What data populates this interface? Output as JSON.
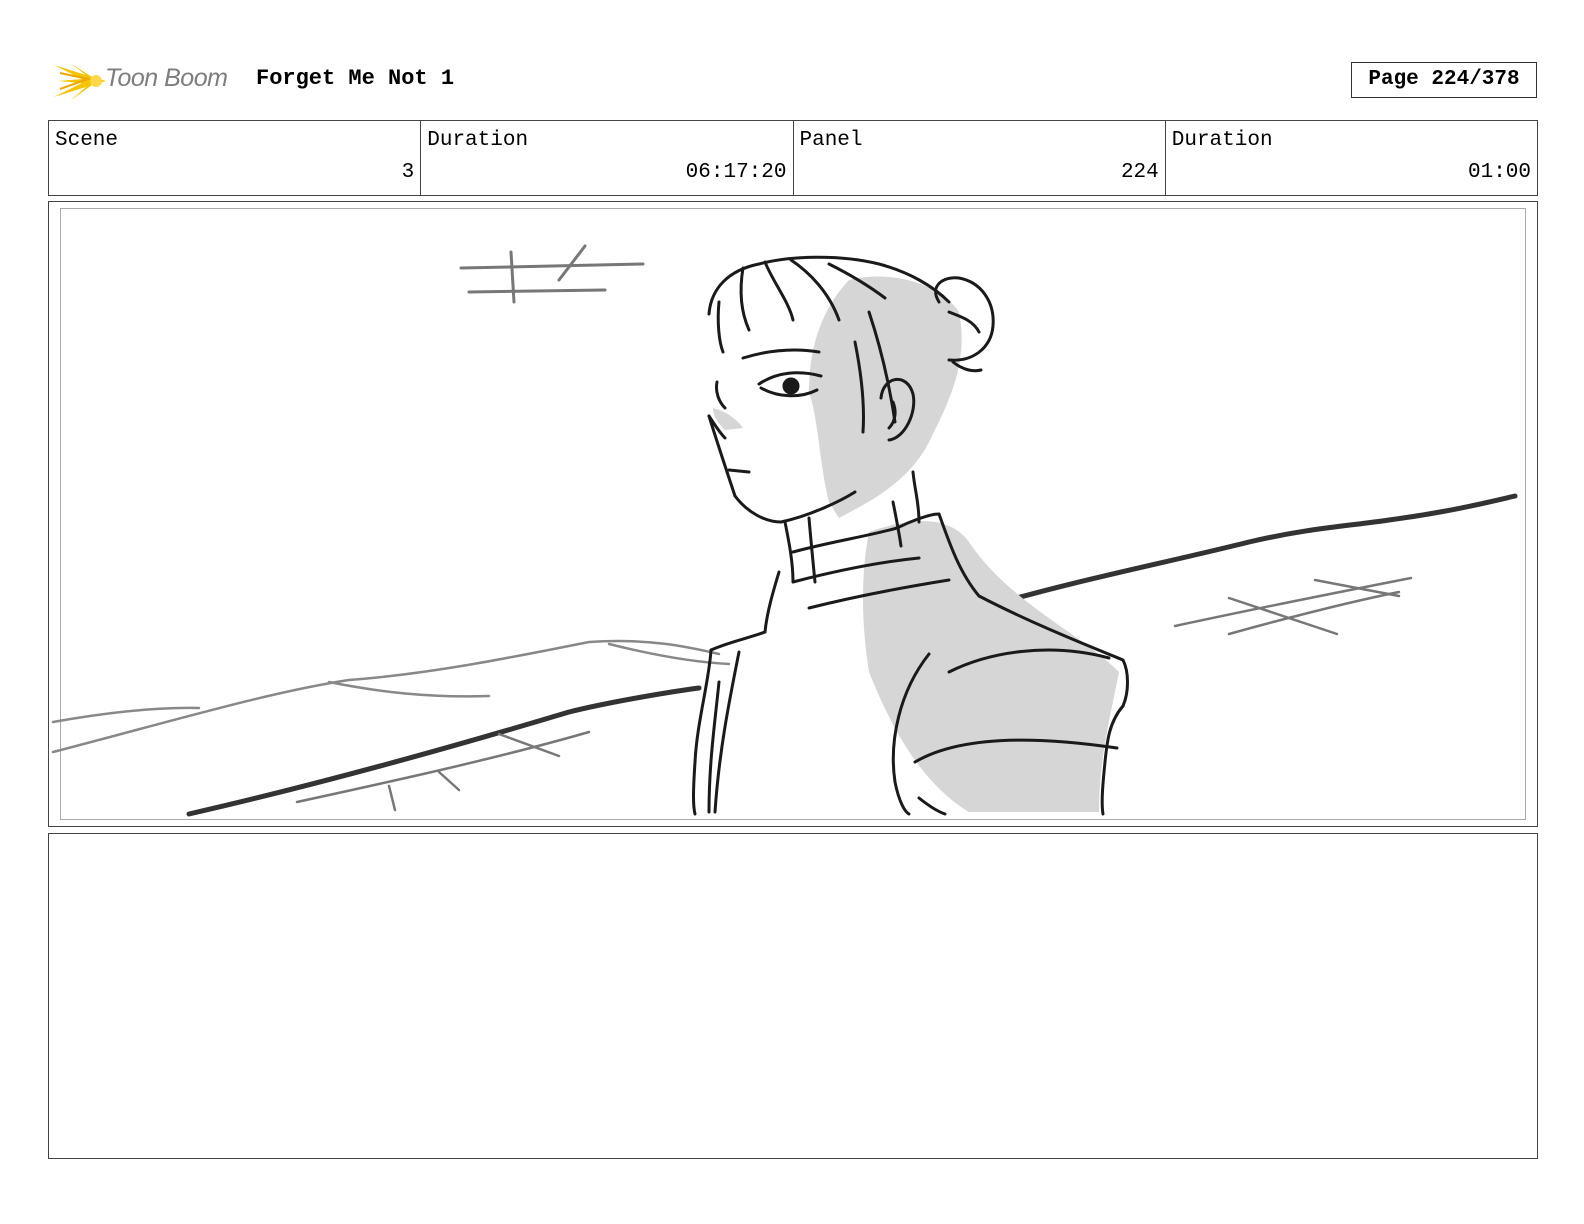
{
  "header": {
    "logo_text": "Toon Boom",
    "project_title": "Forget Me Not 1",
    "page_label": "Page 224/378"
  },
  "info": {
    "scene_label": "Scene",
    "scene_value": "3",
    "scene_duration_label": "Duration",
    "scene_duration_value": "06:17:20",
    "panel_label": "Panel",
    "panel_value": "224",
    "panel_duration_label": "Duration",
    "panel_duration_value": "01:00"
  },
  "colors": {
    "logo_accent": "#f5c400",
    "logo_text": "#7d7d7d",
    "sketch_line": "#1a1a1a",
    "sketch_shadow": "#d6d6d6"
  },
  "panel": {
    "image": "storyboard-sketch-character-looking-left"
  },
  "notes": {
    "text": ""
  }
}
